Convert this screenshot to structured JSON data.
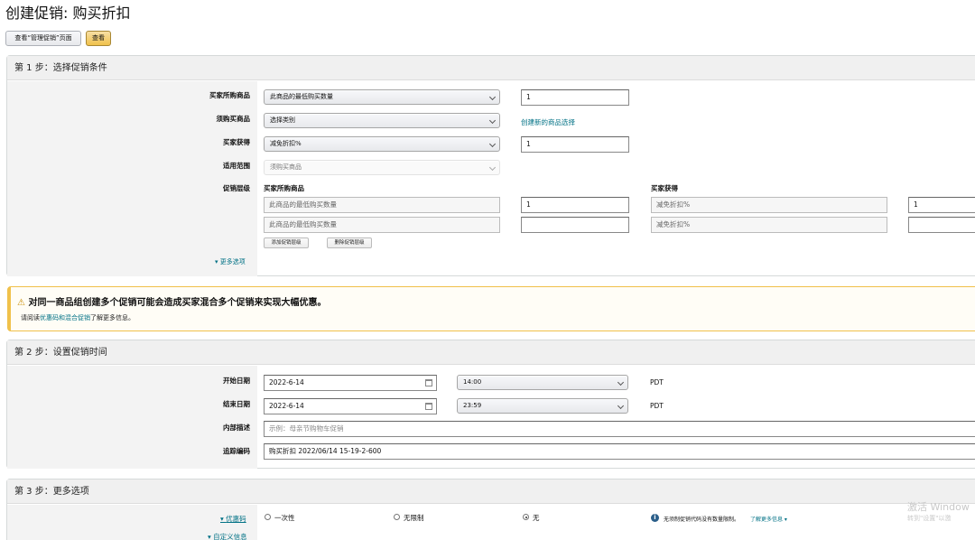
{
  "page": {
    "title": "创建促销: 购买折扣"
  },
  "toolbar": {
    "view_manage_label": "查看“管理促销”页面",
    "view_label": "查看"
  },
  "step1": {
    "heading": "第 1 步：选择促销条件",
    "buyer_buys": {
      "label": "买家所购商品",
      "select": "此商品的最低购买数量",
      "value": "1"
    },
    "purchased_items": {
      "label": "须购买商品",
      "select": "选择类别",
      "link": "创建新的商品选择"
    },
    "buyer_gets": {
      "label": "买家获得",
      "select": "减免折扣%",
      "value": "1"
    },
    "applies_to": {
      "label": "适用范围",
      "select": "须购买商品"
    },
    "tiers": {
      "label": "促销层级",
      "col_buy": "买家所购商品",
      "col_get": "买家获得",
      "rows": [
        {
          "buy_type": "此商品的最低购买数量",
          "buy_value": "1",
          "get_type": "减免折扣%",
          "get_value": "1"
        },
        {
          "buy_type": "此商品的最低购买数量",
          "buy_value": "",
          "get_type": "减免折扣%",
          "get_value": ""
        }
      ],
      "add_label": "添加促销层级",
      "remove_label": "删除促销层级"
    },
    "more_options": "更多选项"
  },
  "warning": {
    "title": "对同一商品组创建多个促销可能会造成买家混合多个促销来实现大幅优惠。",
    "text_before": "请阅读",
    "link": "优惠码和混合促销",
    "text_after": "了解更多信息。"
  },
  "step2": {
    "heading": "第 2 步：设置促销时间",
    "start": {
      "label": "开始日期",
      "date": "2022-6-14",
      "time": "14:00",
      "tz": "PDT"
    },
    "end": {
      "label": "结束日期",
      "date": "2022-6-14",
      "time": "23:59",
      "tz": "PDT"
    },
    "internal_desc": {
      "label": "内部描述",
      "placeholder": "示例：母亲节购物车促销"
    },
    "tracking_code": {
      "label": "追踪编码",
      "value": "购买折扣 2022/06/14 15-19-2-600"
    }
  },
  "step3": {
    "heading": "第 3 步：更多选项",
    "coupon_code": {
      "label": "优惠码",
      "options": [
        "一次性",
        "无限制",
        "无"
      ],
      "selected": "无",
      "info": "无须制促销代码没有数量限制。",
      "learn_more": "了解更多信息"
    },
    "custom_info": "自定义信息"
  },
  "watermark": {
    "line1": "激活 Window",
    "line2": "转到\"设置\"以激"
  },
  "icons": {
    "warning": "warning-icon",
    "calendar": "calendar-icon",
    "info": "info-icon",
    "chevron": "chevron-down-icon"
  },
  "colors": {
    "accent_yellow": "#f0c14b",
    "link": "#007185",
    "warning_border": "#f0c14b"
  }
}
